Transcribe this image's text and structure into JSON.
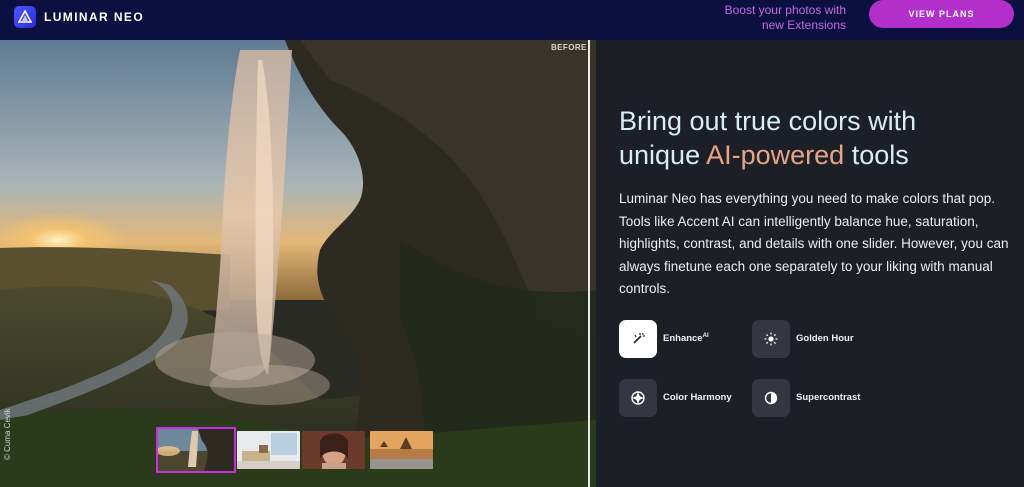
{
  "header": {
    "brand": "LUMINAR NEO",
    "promo_line1": "Boost your photos with",
    "promo_line2": "new Extensions",
    "cta_label": "VIEW PLANS",
    "accent_color": "#b32fcb"
  },
  "viewer": {
    "before_label": "BEFORE",
    "photo_credit": "© Cuma Cevik",
    "thumbnails": [
      "waterfall",
      "interior",
      "portrait",
      "landscape"
    ],
    "selected_thumbnail": "waterfall"
  },
  "content": {
    "headline_part1": "Bring out true colors with",
    "headline_part2": "unique",
    "headline_part3": "AI-powered",
    "headline_part4": "tools",
    "body": "Luminar Neo has everything you need to make colors that pop. Tools like Accent AI can intelligently balance hue, saturation, highlights, contrast, and details with one slider. However, you can always finetune each one separately to your liking with manual controls.",
    "features": [
      {
        "label": "Enhance",
        "sup": "AI",
        "icon": "magic-wand-icon"
      },
      {
        "label": "Golden Hour",
        "icon": "sun-icon"
      },
      {
        "label": "Color Harmony",
        "icon": "aperture-icon"
      },
      {
        "label": "Supercontrast",
        "icon": "contrast-icon"
      }
    ]
  }
}
